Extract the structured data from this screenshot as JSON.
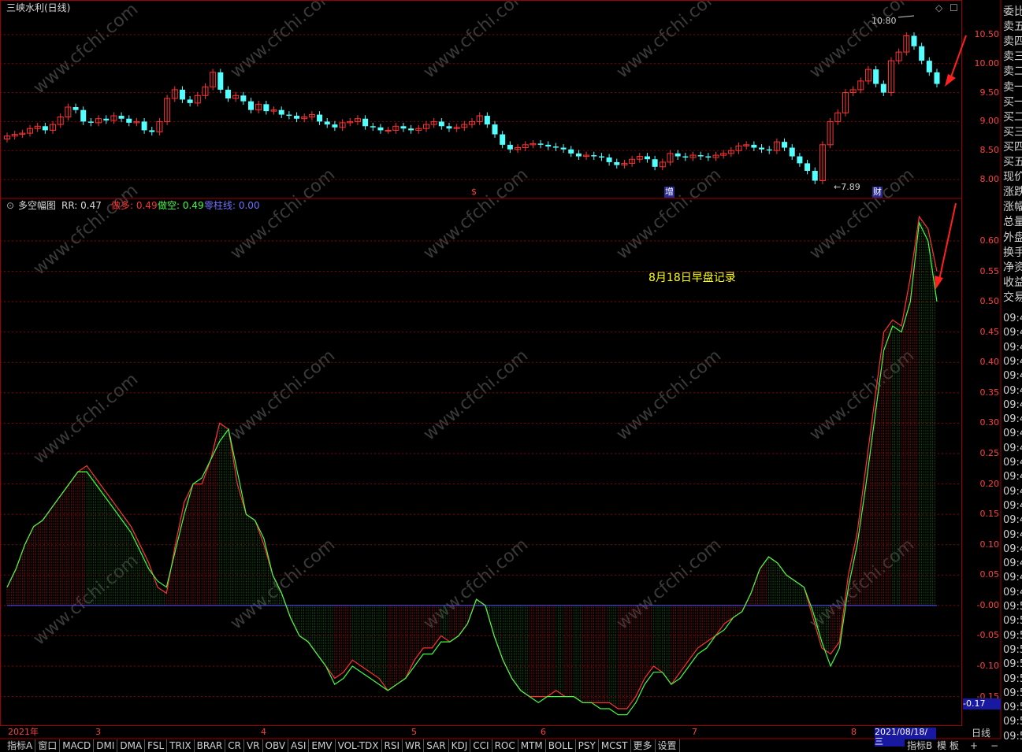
{
  "title": "三峡水利(日线)",
  "indicator": {
    "name": "多空幅图",
    "rr_label": "RR: 0.47",
    "long_label": "做多: 0.49",
    "short_label": "做空: 0.49",
    "zero_label": "零柱线: 0.00"
  },
  "annotation": "8月18日早盘记录",
  "price_high_label": "10.80",
  "price_low_label": "7.89",
  "markers": {
    "left": "$",
    "mid": "增",
    "right": "财"
  },
  "price_axis": [
    "10.50",
    "10.00",
    "9.50",
    "9.00",
    "8.50",
    "8.00"
  ],
  "ind_axis": [
    "0.60",
    "0.55",
    "0.50",
    "0.45",
    "0.40",
    "0.35",
    "0.30",
    "0.25",
    "0.20",
    "0.15",
    "0.10",
    "0.05",
    "-0.00",
    "-0.05",
    "-0.10",
    "-0.15"
  ],
  "cursor_value": "-0.17",
  "period_label": "日线",
  "x_axis": {
    "year": "2021年",
    "months": [
      "3",
      "4",
      "5",
      "6",
      "7",
      "8"
    ],
    "cursor_date": "2021/08/18/三"
  },
  "right_panel": [
    "委比",
    "卖五",
    "卖四",
    "卖三",
    "卖二",
    "卖一",
    "买一",
    "买二",
    "买三",
    "买四",
    "买五",
    "现价",
    "涨跌",
    "涨幅",
    "总量",
    "外盘",
    "换手",
    "净资",
    "收益",
    "交易"
  ],
  "right_times": [
    "09:4",
    "09:4",
    "09:4",
    "09:4",
    "09:4",
    "09:4",
    "09:4",
    "09:4",
    "09:4",
    "09:4",
    "09:4",
    "09:4",
    "09:4",
    "09:4",
    "09:4",
    "09:4",
    "09:4",
    "09:4",
    "09:4",
    "09:4",
    "09:5",
    "09:5",
    "09:5",
    "09:5",
    "09:5",
    "09:5",
    "09:5",
    "09:5",
    "09:5",
    "09:5"
  ],
  "bottom_tabs": [
    "指标A",
    "窗口",
    "MACD",
    "DMI",
    "DMA",
    "FSL",
    "TRIX",
    "BRAR",
    "CR",
    "VR",
    "OBV",
    "ASI",
    "EMV",
    "VOL-TDX",
    "RSI",
    "WR",
    "SAR",
    "KDJ",
    "CCI",
    "ROC",
    "MTM",
    "BOLL",
    "PSY",
    "MCST",
    "更多",
    "设置"
  ],
  "bottom_right": [
    "指标B",
    "模",
    "板",
    "+",
    "−"
  ],
  "watermark": "www.cfchi.com",
  "colors": {
    "up": "#ff3232",
    "down": "#54ffff",
    "long_line": "#ff3232",
    "short_line": "#40ff40",
    "zero_line": "#5050ff",
    "grid": "#8b0000",
    "annotation": "#ffff00"
  },
  "chart_data": [
    {
      "type": "candlestick",
      "title": "三峡水利(日线)",
      "ylim": [
        7.75,
        10.85
      ],
      "high_label": 10.8,
      "low_label": 7.89,
      "closes": [
        8.75,
        8.78,
        8.8,
        8.88,
        8.92,
        8.85,
        8.95,
        9.08,
        9.25,
        9.2,
        9.0,
        8.98,
        9.05,
        9.02,
        9.1,
        9.05,
        8.98,
        9.0,
        8.85,
        8.82,
        9.0,
        9.4,
        9.55,
        9.38,
        9.32,
        9.45,
        9.6,
        9.85,
        9.55,
        9.4,
        9.45,
        9.35,
        9.2,
        9.3,
        9.18,
        9.2,
        9.12,
        9.1,
        9.05,
        9.08,
        9.12,
        9.0,
        8.95,
        8.9,
        8.98,
        9.0,
        9.05,
        8.92,
        8.9,
        8.85,
        8.85,
        8.92,
        8.88,
        8.85,
        8.88,
        8.95,
        9.0,
        8.92,
        8.88,
        8.9,
        8.95,
        9.0,
        9.1,
        8.95,
        8.78,
        8.6,
        8.52,
        8.55,
        8.6,
        8.62,
        8.6,
        8.57,
        8.55,
        8.52,
        8.45,
        8.4,
        8.42,
        8.4,
        8.38,
        8.3,
        8.25,
        8.28,
        8.35,
        8.4,
        8.35,
        8.22,
        8.3,
        8.45,
        8.4,
        8.38,
        8.42,
        8.4,
        8.38,
        8.42,
        8.45,
        8.5,
        8.58,
        8.6,
        8.55,
        8.52,
        8.5,
        8.65,
        8.55,
        8.4,
        8.28,
        8.15,
        7.98,
        8.6,
        9.0,
        9.15,
        9.5,
        9.55,
        9.7,
        9.9,
        9.65,
        9.5,
        10.05,
        10.2,
        10.48,
        10.3,
        10.05,
        9.85,
        9.65
      ],
      "indicator": {
        "name": "多空幅图",
        "ylim": [
          -0.2,
          0.65
        ],
        "long_line": [
          0.03,
          0.06,
          0.1,
          0.13,
          0.14,
          0.16,
          0.18,
          0.2,
          0.22,
          0.23,
          0.21,
          0.19,
          0.17,
          0.15,
          0.13,
          0.1,
          0.07,
          0.03,
          0.02,
          0.1,
          0.17,
          0.2,
          0.2,
          0.24,
          0.3,
          0.29,
          0.2,
          0.15,
          0.14,
          0.1,
          0.05,
          0.02,
          -0.02,
          -0.05,
          -0.06,
          -0.08,
          -0.1,
          -0.12,
          -0.11,
          -0.09,
          -0.1,
          -0.11,
          -0.12,
          -0.14,
          -0.13,
          -0.12,
          -0.09,
          -0.07,
          -0.07,
          -0.05,
          -0.06,
          -0.05,
          -0.03,
          0.01,
          0.0,
          -0.05,
          -0.09,
          -0.12,
          -0.14,
          -0.15,
          -0.15,
          -0.15,
          -0.14,
          -0.15,
          -0.15,
          -0.16,
          -0.16,
          -0.16,
          -0.16,
          -0.17,
          -0.17,
          -0.15,
          -0.12,
          -0.1,
          -0.11,
          -0.13,
          -0.11,
          -0.09,
          -0.07,
          -0.06,
          -0.05,
          -0.03,
          -0.02,
          -0.01,
          0.02,
          0.06,
          0.08,
          0.07,
          0.05,
          0.04,
          0.03,
          -0.02,
          -0.07,
          -0.08,
          -0.06,
          0.05,
          0.12,
          0.23,
          0.34,
          0.45,
          0.47,
          0.46,
          0.54,
          0.64,
          0.62,
          0.55
        ],
        "short_line": [
          0.03,
          0.06,
          0.1,
          0.13,
          0.14,
          0.16,
          0.18,
          0.2,
          0.22,
          0.22,
          0.2,
          0.18,
          0.16,
          0.14,
          0.12,
          0.09,
          0.06,
          0.04,
          0.03,
          0.09,
          0.15,
          0.2,
          0.21,
          0.24,
          0.27,
          0.29,
          0.22,
          0.15,
          0.14,
          0.11,
          0.05,
          0.02,
          -0.02,
          -0.05,
          -0.06,
          -0.08,
          -0.1,
          -0.13,
          -0.12,
          -0.1,
          -0.11,
          -0.12,
          -0.13,
          -0.14,
          -0.13,
          -0.12,
          -0.1,
          -0.08,
          -0.08,
          -0.06,
          -0.06,
          -0.05,
          -0.03,
          0.01,
          0.0,
          -0.05,
          -0.09,
          -0.12,
          -0.14,
          -0.15,
          -0.16,
          -0.15,
          -0.15,
          -0.15,
          -0.15,
          -0.16,
          -0.16,
          -0.17,
          -0.17,
          -0.18,
          -0.18,
          -0.16,
          -0.13,
          -0.11,
          -0.11,
          -0.13,
          -0.12,
          -0.1,
          -0.08,
          -0.07,
          -0.05,
          -0.04,
          -0.02,
          -0.01,
          0.02,
          0.06,
          0.08,
          0.07,
          0.05,
          0.04,
          0.03,
          -0.01,
          -0.06,
          -0.1,
          -0.07,
          0.03,
          0.1,
          0.2,
          0.31,
          0.42,
          0.46,
          0.45,
          0.5,
          0.63,
          0.6,
          0.5
        ]
      }
    }
  ]
}
